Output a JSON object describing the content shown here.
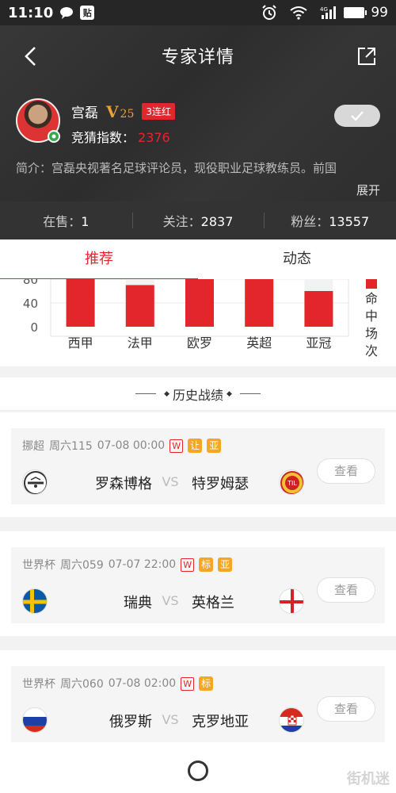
{
  "status_bar": {
    "time": "11:10",
    "badge": "贴",
    "battery": "99",
    "signal": "4G"
  },
  "nav": {
    "title": "专家详情"
  },
  "expert": {
    "name": "宫磊",
    "vip_prefix": "V",
    "vip_level": "25",
    "streak": "3连红",
    "index_label": "竞猜指数：",
    "index_value": "2376",
    "intro": "简介：宫磊央视著名足球评论员，现役职业足球教练员。前国",
    "expand": "展开"
  },
  "stats": [
    {
      "label": "在售：",
      "value": "1"
    },
    {
      "label": "关注：",
      "value": "2837"
    },
    {
      "label": "粉丝：",
      "value": "13557"
    }
  ],
  "tabs": [
    {
      "label": "推荐",
      "active": true
    },
    {
      "label": "动态",
      "active": false
    }
  ],
  "chart_data": {
    "type": "bar",
    "categories": [
      "西甲",
      "法甲",
      "欧罗",
      "英超",
      "亚冠"
    ],
    "values": [
      100,
      70,
      100,
      100,
      60
    ],
    "ylim": [
      0,
      100
    ],
    "yticks": [
      "0",
      "40",
      "80"
    ],
    "legend": "命中场次",
    "colors": {
      "bar": "#e3262c",
      "remaining": "#f2f2f2"
    }
  },
  "history": {
    "title": "历史战绩"
  },
  "matches": [
    {
      "league": "挪超",
      "week": "周六115",
      "datetime": "07-08 00:00",
      "tags": [
        "W",
        "让",
        "亚"
      ],
      "home": "罗森博格",
      "vs": "VS",
      "away": "特罗姆瑟",
      "home_icon": "rosenborg-logo-icon",
      "away_icon": "tromso-logo-icon",
      "button": "查看"
    },
    {
      "league": "世界杯",
      "week": "周六059",
      "datetime": "07-07 22:00",
      "tags": [
        "W",
        "标",
        "亚"
      ],
      "home": "瑞典",
      "vs": "VS",
      "away": "英格兰",
      "home_icon": "sweden-flag-icon",
      "away_icon": "england-flag-icon",
      "button": "查看"
    },
    {
      "league": "世界杯",
      "week": "周六060",
      "datetime": "07-08 02:00",
      "tags": [
        "W",
        "标"
      ],
      "home": "俄罗斯",
      "vs": "VS",
      "away": "克罗地亚",
      "home_icon": "russia-flag-icon",
      "away_icon": "croatia-flag-icon",
      "button": "查看"
    }
  ],
  "watermark": "街机迷"
}
